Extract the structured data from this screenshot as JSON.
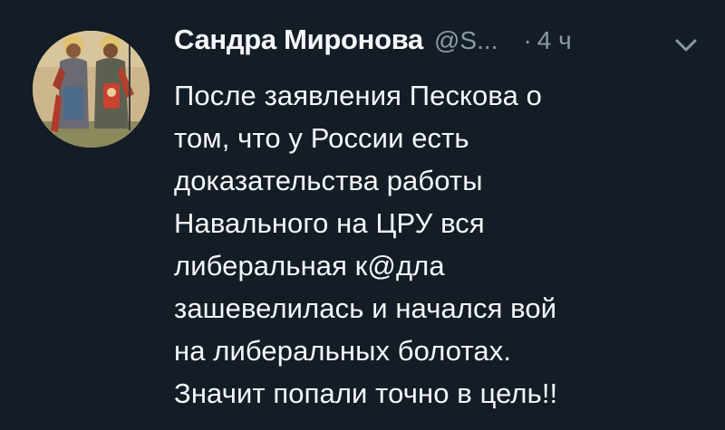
{
  "tweet": {
    "author": {
      "display_name": "Сандра Миронова",
      "handle": "@S...",
      "avatar_icon": "avatar-saints-icon"
    },
    "separator": "·",
    "time": "4 ч",
    "menu_icon": "chevron-down-icon",
    "lines": [
      "После заявления Пескова о",
      "том, что у России есть",
      "доказательства работы",
      "Навального на ЦРУ вся",
      "либеральная к@дла",
      "зашевелилась и начался вой",
      "на либеральных болотах.",
      "Значит попали точно в цель!!"
    ]
  },
  "colors": {
    "background": "#141d26",
    "text_primary": "#f5f8fa",
    "text_secondary": "#8899a6"
  }
}
